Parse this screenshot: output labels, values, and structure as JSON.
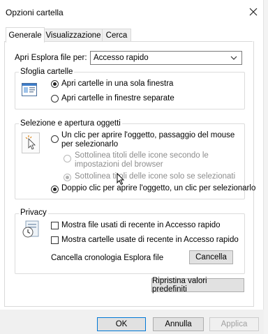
{
  "window": {
    "title": "Opzioni cartella"
  },
  "tabs": [
    {
      "label": "Generale"
    },
    {
      "label": "Visualizzazione"
    },
    {
      "label": "Cerca"
    }
  ],
  "open_explorer": {
    "label": "Apri Esplora file per:",
    "value": "Accesso rapido"
  },
  "browse": {
    "legend": "Sfoglia cartelle",
    "options": [
      {
        "label": "Apri cartelle in una sola finestra",
        "selected": true
      },
      {
        "label": "Apri cartelle in finestre separate",
        "selected": false
      }
    ]
  },
  "click": {
    "legend": "Selezione e apertura oggetti",
    "single": {
      "line1": "Un clic per aprire l'oggetto, passaggio del mouse",
      "line2": "per selezionarlo"
    },
    "sub1": {
      "line1": "Sottolinea titoli delle icone secondo le",
      "line2": "impostazioni del browser"
    },
    "sub2": {
      "label": "Sottolinea titoli delle icone solo se selezionati"
    },
    "double": {
      "label": "Doppio clic per aprire l'oggetto, un clic per selezionarlo"
    }
  },
  "privacy": {
    "legend": "Privacy",
    "recent_files": "Mostra file usati di recente in Accesso rapido",
    "recent_folders": "Mostra cartelle usate di recente in Accesso rapido",
    "clear_label": "Cancella cronologia Esplora file",
    "clear_button": "Cancella"
  },
  "restore_button": "Ripristina valori predefiniti",
  "footer": {
    "ok": "OK",
    "cancel": "Annulla",
    "apply": "Applica"
  }
}
